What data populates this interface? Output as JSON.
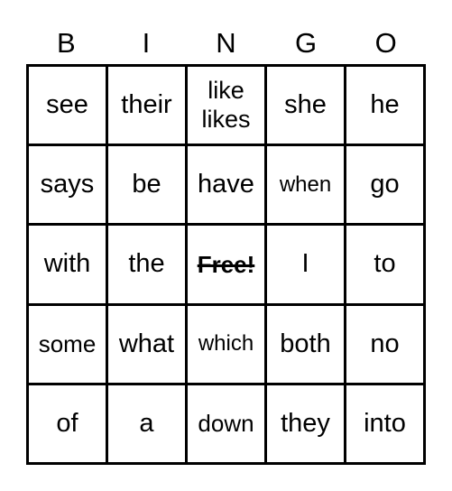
{
  "card": {
    "title": "BINGO",
    "headers": [
      "B",
      "I",
      "N",
      "G",
      "O"
    ],
    "rows": [
      [
        {
          "text": "see",
          "size": "normal",
          "free": false
        },
        {
          "text": "their",
          "size": "normal",
          "free": false
        },
        {
          "text": "like\nlikes",
          "size": "two-line",
          "free": false
        },
        {
          "text": "she",
          "size": "normal",
          "free": false
        },
        {
          "text": "he",
          "size": "normal",
          "free": false
        }
      ],
      [
        {
          "text": "says",
          "size": "normal",
          "free": false
        },
        {
          "text": "be",
          "size": "normal",
          "free": false
        },
        {
          "text": "have",
          "size": "normal",
          "free": false
        },
        {
          "text": "when",
          "size": "small",
          "free": false
        },
        {
          "text": "go",
          "size": "normal",
          "free": false
        }
      ],
      [
        {
          "text": "with",
          "size": "normal",
          "free": false
        },
        {
          "text": "the",
          "size": "normal",
          "free": false
        },
        {
          "text": "Free!",
          "size": "normal",
          "free": true
        },
        {
          "text": "I",
          "size": "normal",
          "free": false
        },
        {
          "text": "to",
          "size": "normal",
          "free": false
        }
      ],
      [
        {
          "text": "some",
          "size": "medium",
          "free": false
        },
        {
          "text": "what",
          "size": "normal",
          "free": false
        },
        {
          "text": "which",
          "size": "small",
          "free": false
        },
        {
          "text": "both",
          "size": "normal",
          "free": false
        },
        {
          "text": "no",
          "size": "normal",
          "free": false
        }
      ],
      [
        {
          "text": "of",
          "size": "normal",
          "free": false
        },
        {
          "text": "a",
          "size": "normal",
          "free": false
        },
        {
          "text": "down",
          "size": "medium",
          "free": false
        },
        {
          "text": "they",
          "size": "normal",
          "free": false
        },
        {
          "text": "into",
          "size": "normal",
          "free": false
        }
      ]
    ],
    "colors": {
      "background": "#ffffff",
      "ink": "#000000",
      "border": "#000000"
    }
  }
}
